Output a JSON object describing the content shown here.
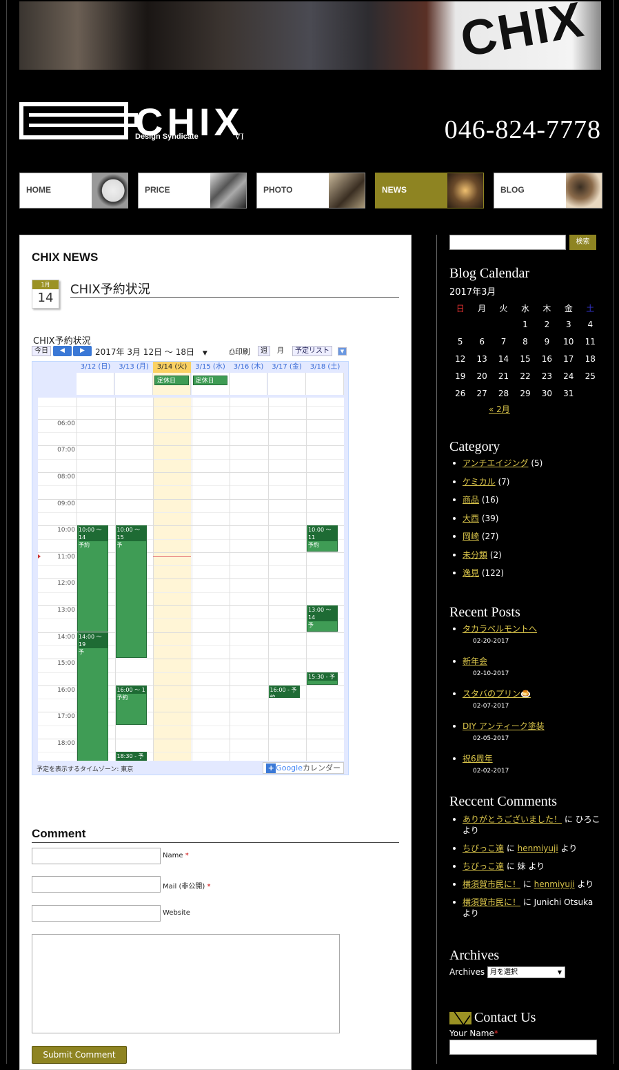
{
  "header": {
    "phone": "046-824-7778",
    "logo_text": "CHIX",
    "logo_sub": "Design Syndicate",
    "logo_vi": "VI",
    "banner_sign": "CHIX"
  },
  "nav": [
    {
      "label": "HOME"
    },
    {
      "label": "PRICE"
    },
    {
      "label": "PHOTO"
    },
    {
      "label": "NEWS"
    },
    {
      "label": "BLOG"
    }
  ],
  "main": {
    "section_title": "CHIX NEWS",
    "post": {
      "month": "1月",
      "day": "14",
      "title": "CHIX予約状況"
    },
    "calendar": {
      "title": "CHIX予約状況",
      "today_btn": "今日",
      "prev": "◀",
      "next": "▶",
      "range": "2017年 3月 12日 ～ 18日",
      "print": "印刷",
      "week": "週",
      "month": "月",
      "agenda": "予定リスト",
      "days": [
        "3/12 (日)",
        "3/13 (月)",
        "3/14 (火)",
        "3/15 (水)",
        "3/16 (木)",
        "3/17 (金)",
        "3/18 (土)"
      ],
      "allday_label": "定休日",
      "times": [
        "06:00",
        "07:00",
        "08:00",
        "09:00",
        "10:00",
        "11:00",
        "12:00",
        "13:00",
        "14:00",
        "15:00",
        "16:00",
        "17:00",
        "18:00"
      ],
      "events": [
        {
          "day": 0,
          "start": 10,
          "end": 14,
          "head": "10:00 ～ 14",
          "body": "予約"
        },
        {
          "day": 0,
          "start": 14,
          "end": 19,
          "head": "14:00 ～ 19",
          "body": "予"
        },
        {
          "day": 1,
          "start": 10,
          "end": 15,
          "head": "10:00 ～ 15",
          "body": "予"
        },
        {
          "day": 1,
          "start": 16,
          "end": 17.5,
          "head": "16:00 ～ 1",
          "body": "予約"
        },
        {
          "day": 1,
          "start": 18.5,
          "end": 19,
          "head": "18:30 - 予約",
          "body": ""
        },
        {
          "day": 5,
          "start": 16,
          "end": 16.5,
          "head": "16:00 - 予約",
          "body": ""
        },
        {
          "day": 6,
          "start": 10,
          "end": 11,
          "head": "10:00 ～ 11",
          "body": "予約"
        },
        {
          "day": 6,
          "start": 13,
          "end": 14,
          "head": "13:00 ～ 14",
          "body": "予"
        },
        {
          "day": 6,
          "start": 15.5,
          "end": 16,
          "head": "15:30 - 予",
          "body": ""
        }
      ],
      "timezone": "予定を表示するタイムゾーン: 東京",
      "google": "Google",
      "google_suffix": "カレンダー"
    },
    "comment": {
      "title": "Comment",
      "name_label": "Name",
      "mail_label": "Mail (非公開)",
      "website_label": "Website",
      "required": "*",
      "submit": "Submit Comment"
    }
  },
  "sidebar": {
    "search_btn": "検索",
    "blog_calendar": {
      "title": "Blog Calendar",
      "month": "2017年3月",
      "weekdays": [
        "日",
        "月",
        "火",
        "水",
        "木",
        "金",
        "土"
      ],
      "weeks": [
        [
          "",
          "",
          "",
          "1",
          "2",
          "3",
          "4"
        ],
        [
          "5",
          "6",
          "7",
          "8",
          "9",
          "10",
          "11"
        ],
        [
          "12",
          "13",
          "14",
          "15",
          "16",
          "17",
          "18"
        ],
        [
          "19",
          "20",
          "21",
          "22",
          "23",
          "24",
          "25"
        ],
        [
          "26",
          "27",
          "28",
          "29",
          "30",
          "31",
          ""
        ]
      ],
      "prev": "« 2月"
    },
    "category": {
      "title": "Category",
      "items": [
        {
          "name": "アンチエイジング",
          "count": "(5)"
        },
        {
          "name": "ケミカル",
          "count": "(7)"
        },
        {
          "name": "商品",
          "count": "(16)"
        },
        {
          "name": "大西",
          "count": "(39)"
        },
        {
          "name": "岡崎",
          "count": "(27)"
        },
        {
          "name": "未分類",
          "count": "(2)"
        },
        {
          "name": "逸見",
          "count": "(122)"
        }
      ]
    },
    "recent_posts": {
      "title": "Recent Posts",
      "items": [
        {
          "title": "タカラベルモントへ",
          "date": "02-20-2017"
        },
        {
          "title": "新年会",
          "date": "02-10-2017"
        },
        {
          "title": "スタバのプリン🍮",
          "date": "02-07-2017"
        },
        {
          "title": "DIY アンティーク塗装",
          "date": "02-05-2017"
        },
        {
          "title": "祝6周年",
          "date": "02-02-2017"
        }
      ]
    },
    "recent_comments": {
      "title": "Reccent Comments",
      "items": [
        {
          "post": "ありがとうございました！",
          "mid": " に ひろこ より",
          "author": ""
        },
        {
          "post": "ちびっこ達",
          "mid": " に ",
          "author": "henmiyuji",
          "end": " より"
        },
        {
          "post": "ちびっこ達",
          "mid": " に 妹 より",
          "author": ""
        },
        {
          "post": "横須賀市民に！",
          "mid": " に ",
          "author": "henmiyuji",
          "end": " より"
        },
        {
          "post": "横須賀市民に！",
          "mid": " に Junichi Otsuka より",
          "author": ""
        }
      ]
    },
    "archives": {
      "title": "Archives",
      "label": "Archives",
      "select": "月を選択"
    },
    "contact": {
      "title": "Contact Us",
      "your_name": "Your Name",
      "required": "*"
    }
  }
}
